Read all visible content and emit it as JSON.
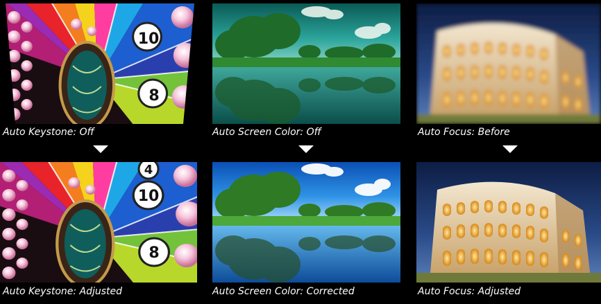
{
  "rows": {
    "before": {
      "keystone_caption": "Auto Keystone: Off",
      "color_caption": "Auto Screen Color: Off",
      "focus_caption": "Auto Focus: Before"
    },
    "after": {
      "keystone_caption": "Auto Keystone: Adjusted",
      "color_caption": "Auto Screen Color: Corrected",
      "focus_caption": "Auto Focus: Adjusted"
    }
  },
  "wheel_numbers": {
    "before": [
      "10",
      "8"
    ],
    "after": [
      "4",
      "10",
      "8"
    ]
  },
  "colors": {
    "background": "#000000",
    "caption_text": "#ffffff",
    "arrow": "#ffffff"
  }
}
